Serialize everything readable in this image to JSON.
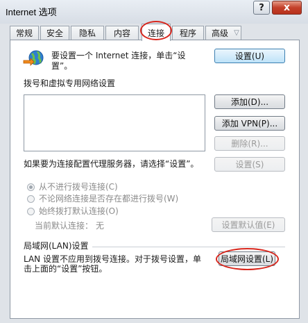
{
  "window": {
    "title": "Internet 选项",
    "help_glyph": "?",
    "close_glyph": "x"
  },
  "tabs": [
    {
      "label": "常规"
    },
    {
      "label": "安全"
    },
    {
      "label": "隐私"
    },
    {
      "label": "内容"
    },
    {
      "label": "连接",
      "active": true
    },
    {
      "label": "程序"
    },
    {
      "label": "高级"
    }
  ],
  "setup": {
    "text": "要设置一个 Internet 连接，单击“设置”。",
    "button": "设置(U)"
  },
  "dialup": {
    "heading": "拨号和虚拟专用网络设置",
    "add_button": "添加(D)...",
    "add_vpn_button": "添加 VPN(P)...",
    "delete_button": "删除(R)...",
    "proxy_text": "如果要为连接配置代理服务器，请选择“设置”。",
    "settings_button": "设置(S)",
    "radio_never": "从不进行拨号连接(C)",
    "radio_when_none": "不论网络连接是否存在都进行拨号(W)",
    "radio_always": "始终拨打默认连接(O)",
    "current_default_label": "当前默认连接：",
    "current_default_value": "无",
    "set_default_button": "设置默认值(E)"
  },
  "lan": {
    "heading": "局域网(LAN)设置",
    "text_line1": "LAN 设置不应用到拨号连接。对于拨号设置，单",
    "text_line2": "击上面的“设置”按钮。",
    "button": "局域网设置(L)"
  },
  "colors": {
    "highlight": "#d8261c",
    "close_button": "#c4402a"
  }
}
